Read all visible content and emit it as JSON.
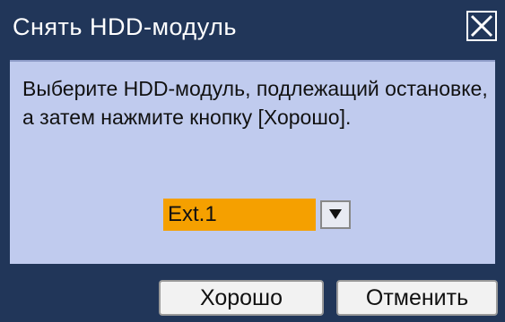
{
  "dialog": {
    "title": "Снять HDD-модуль",
    "close_icon": "close-icon",
    "message_line1": "Выберите HDD-модуль, подлежащий остановке,",
    "message_line2": "а затем нажмите кнопку [Хорошо].",
    "select": {
      "value": "Ext.1",
      "arrow_icon": "triangle-down-icon"
    },
    "ok_label": "Хорошо",
    "cancel_label": "Отменить"
  },
  "colors": {
    "titlebar": "#213659",
    "content_bg": "#c0cbee",
    "select_highlight": "#f5a000"
  }
}
